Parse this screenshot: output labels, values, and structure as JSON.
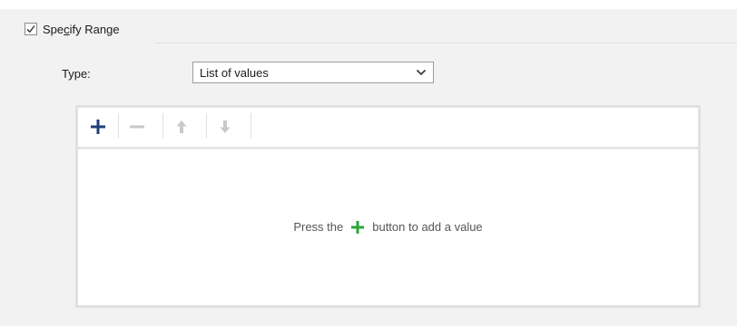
{
  "section": {
    "checkbox_checked": true,
    "label_before": "Spe",
    "label_mnemonic": "c",
    "label_after": "ify Range"
  },
  "type_field": {
    "label": "Type:",
    "selected": "List of values"
  },
  "toolbar": {
    "buttons": [
      "plus-icon",
      "minus-icon",
      "arrow-up-icon",
      "arrow-down-icon"
    ]
  },
  "empty_state": {
    "before": "Press the",
    "after": "button to add a value"
  },
  "colors": {
    "add_icon": "#1f3e7a",
    "disabled_icon": "#c9c9c9",
    "green_plus": "#2aa63a"
  }
}
